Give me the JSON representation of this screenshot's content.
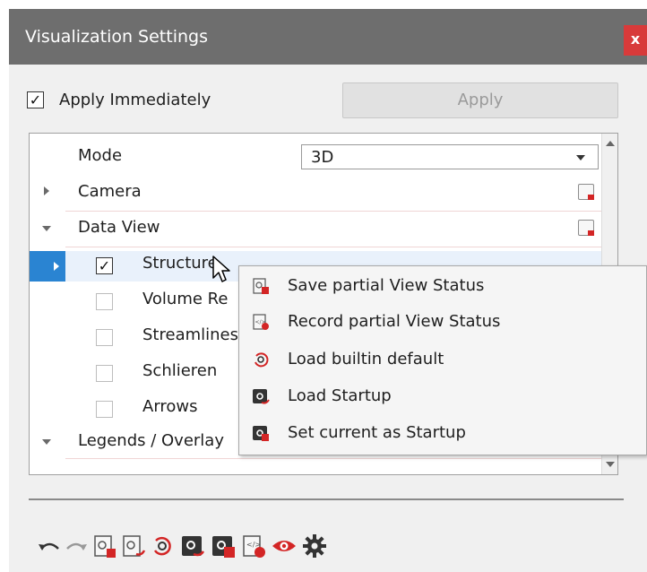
{
  "window": {
    "title": "Visualization Settings",
    "close_label": "x"
  },
  "apply_immediately": {
    "label": "Apply Immediately",
    "checked": true,
    "check_glyph": "✓"
  },
  "apply_button": {
    "label": "Apply",
    "enabled": false
  },
  "tree": {
    "mode": {
      "label": "Mode",
      "value": "3D"
    },
    "camera": {
      "label": "Camera"
    },
    "data_view": {
      "label": "Data View"
    },
    "items": [
      {
        "label": "Structure",
        "checked": true,
        "check_glyph": "✓"
      },
      {
        "label": "Volume Re",
        "checked": false
      },
      {
        "label": "Streamlines",
        "checked": false
      },
      {
        "label": "Schlieren",
        "checked": false
      },
      {
        "label": "Arrows",
        "checked": false
      }
    ],
    "legends": {
      "label": "Legends / Overlay"
    }
  },
  "context_menu": {
    "items": [
      {
        "label": "Save partial View Status",
        "icon": "save-partial-icon"
      },
      {
        "label": "Record partial View Status",
        "icon": "record-partial-icon"
      },
      {
        "label": "Load builtin default",
        "icon": "load-builtin-icon"
      },
      {
        "label": "Load Startup",
        "icon": "load-startup-icon"
      },
      {
        "label": "Set current as Startup",
        "icon": "set-startup-icon"
      }
    ]
  },
  "toolbar": {
    "buttons": [
      "undo-icon",
      "redo-icon",
      "save-view-icon",
      "load-view-icon",
      "reset-icon",
      "load-startup-icon",
      "set-startup-icon",
      "record-icon",
      "visibility-icon",
      "settings-icon"
    ]
  },
  "colors": {
    "title_bar": "#6e6e6e",
    "close_button": "#d83a3a",
    "selection": "#2a84d2",
    "accent_red": "#d32525"
  }
}
